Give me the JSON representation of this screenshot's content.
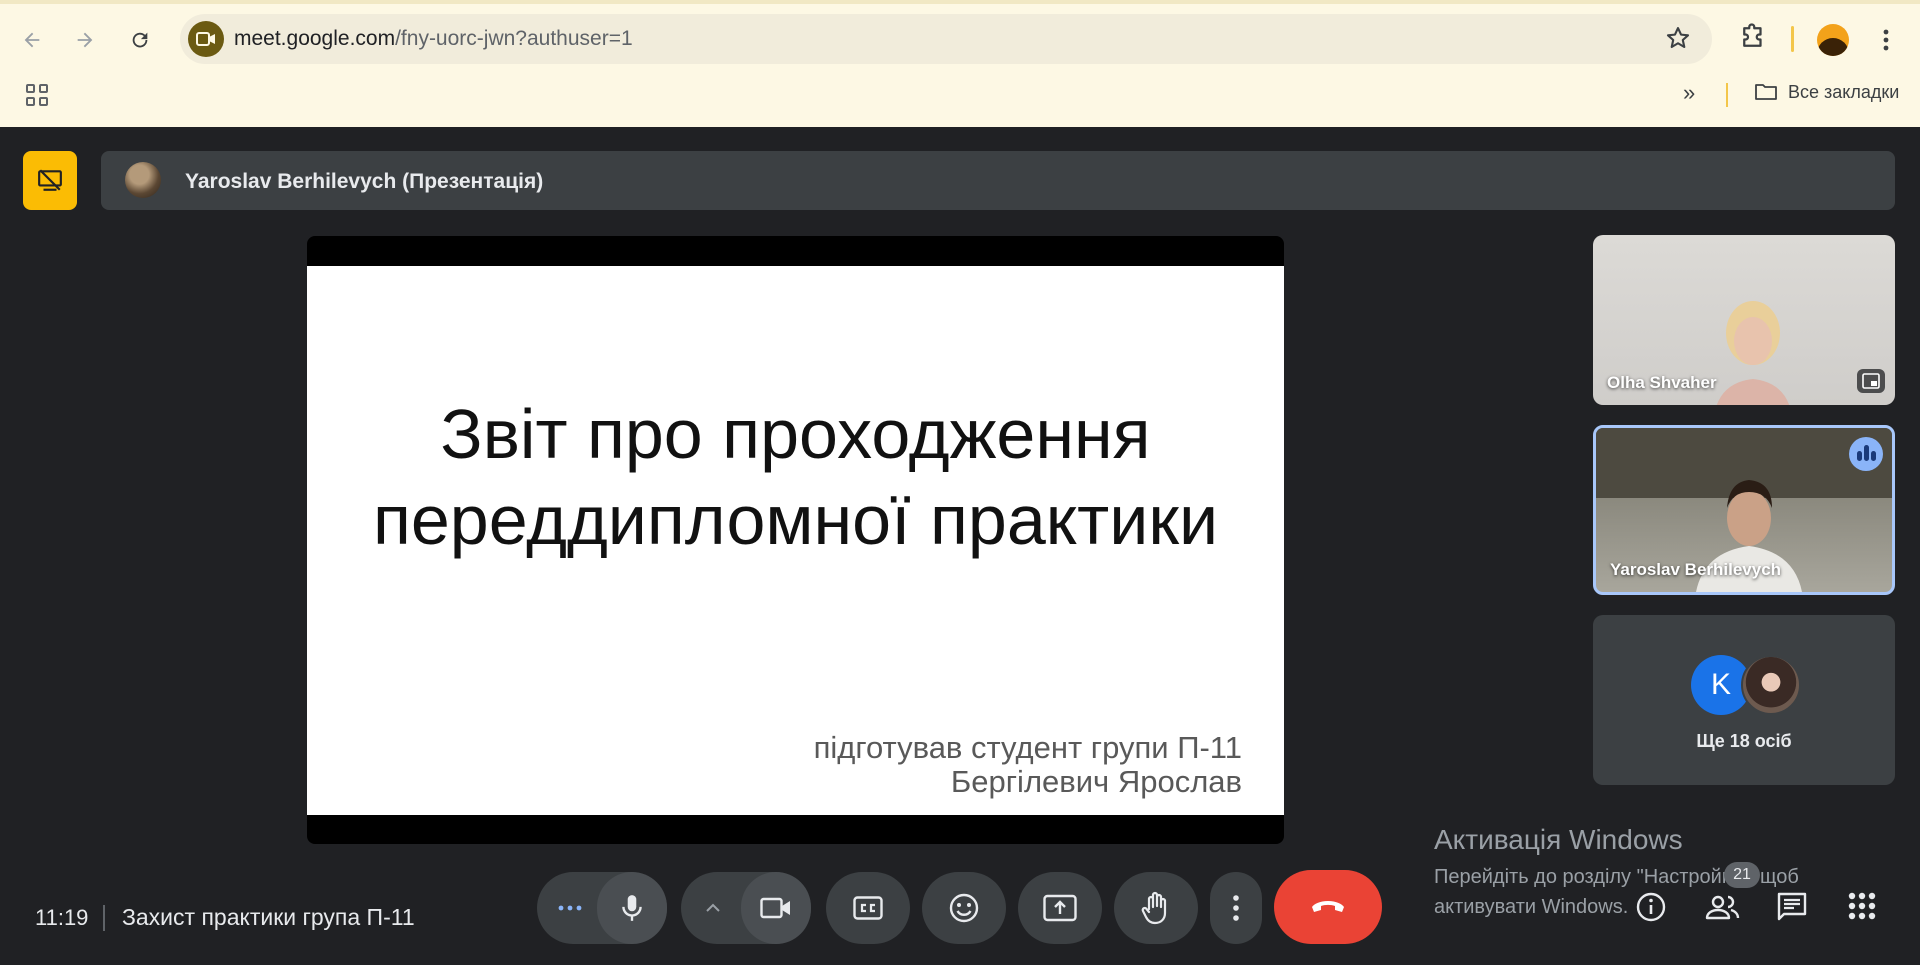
{
  "browser": {
    "url_host": "meet.google.com",
    "url_path": "/fny-uorc-jwn?authuser=1",
    "bookmarks_all_label": "Все закладки"
  },
  "meet": {
    "presenter_bar_title": "Yaroslav Berhilevych (Презентація)",
    "slide": {
      "title_line1": "Звіт про проходження",
      "title_line2": "переддипломної практики",
      "subtitle_line1": "підготував студент групи П-11",
      "subtitle_line2": "Бергілевич Ярослав"
    },
    "participants": [
      {
        "name": "Olha Shvaher"
      },
      {
        "name": "Yaroslav Berhilevych",
        "speaking": true
      }
    ],
    "more_tile": {
      "avatar_letter": "K",
      "label": "Ще 18 осіб"
    },
    "clock": "11:19",
    "meeting_name": "Захист практики група П-11",
    "people_count": "21",
    "watermark": {
      "title": "Активація Windows",
      "line1": "Перейдіть до розділу \"Настройки\", щоб",
      "line2": "активувати Windows."
    },
    "colors": {
      "end_call": "#ea4335",
      "present_highlight": "#fbbc04",
      "speaking_border": "#a8c7fa"
    }
  }
}
